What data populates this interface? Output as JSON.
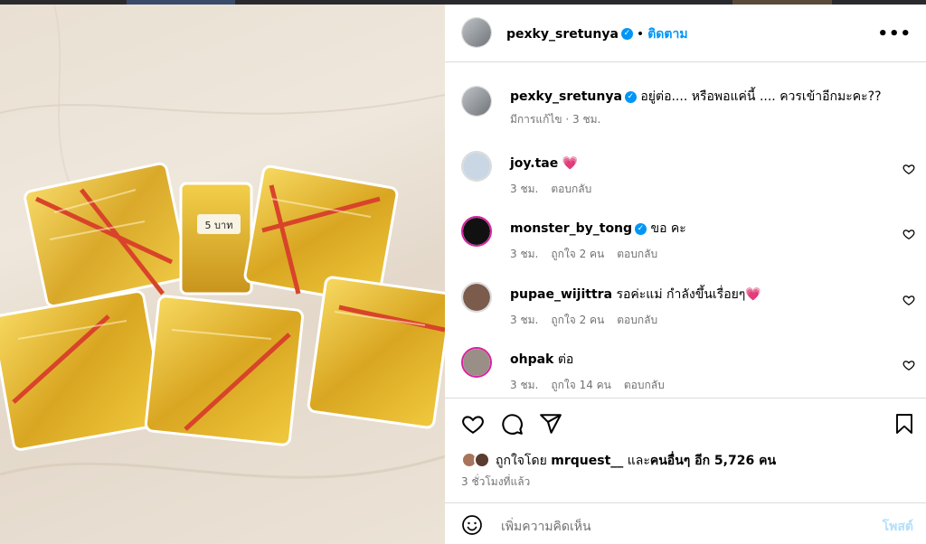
{
  "post": {
    "author": "pexky_sretunya",
    "follow_label": "ติดตาม",
    "caption": "อยู่ต่อ.... หรือพอแค่นี้ .... ควรเข้าอีกมะคะ??",
    "caption_meta": "มีการแก้ไข · 3 ชม.",
    "photo_label": "5 บาท",
    "likes_prefix": "ถูกใจโดย",
    "likes_user": "mrquest__",
    "likes_and": "และ",
    "likes_others": "คนอื่นๆ อีก 5,726 คน",
    "time_ago": "3 ชั่วโมงที่แล้ว"
  },
  "comments": [
    {
      "user": "joy.tae",
      "verified": false,
      "text": "💗",
      "time": "3 ชม.",
      "likes": "",
      "reply": "ตอบกลับ",
      "avatar_color": "#c9d6e3"
    },
    {
      "user": "monster_by_tong",
      "verified": true,
      "text": "ขอ คะ",
      "time": "3 ชม.",
      "likes": "ถูกใจ 2 คน",
      "reply": "ตอบกลับ",
      "avatar_color": "#111111"
    },
    {
      "user": "pupae_wijittra",
      "verified": false,
      "text": "รอค่ะแม่ กำลังขึ้นเรื่อยๆ💗",
      "time": "3 ชม.",
      "likes": "ถูกใจ 2 คน",
      "reply": "ตอบกลับ",
      "avatar_color": "#7a5b4c"
    },
    {
      "user": "ohpak",
      "verified": false,
      "text": "ต่อ",
      "time": "3 ชม.",
      "likes": "ถูกใจ 14 คน",
      "reply": "ตอบกลับ",
      "avatar_color": "#9a8f86"
    }
  ],
  "composer": {
    "placeholder": "เพิ่มความคิดเห็น",
    "post_label": "โพสต์"
  },
  "icons": [
    "more-icon",
    "heart-icon",
    "comment-icon",
    "share-icon",
    "bookmark-icon",
    "emoji-icon",
    "verified-icon"
  ],
  "colors": {
    "accent": "#0095f6",
    "muted": "#737373",
    "border": "#dbdbdb",
    "gold": "#e0b42a",
    "band": "#d8442a"
  }
}
